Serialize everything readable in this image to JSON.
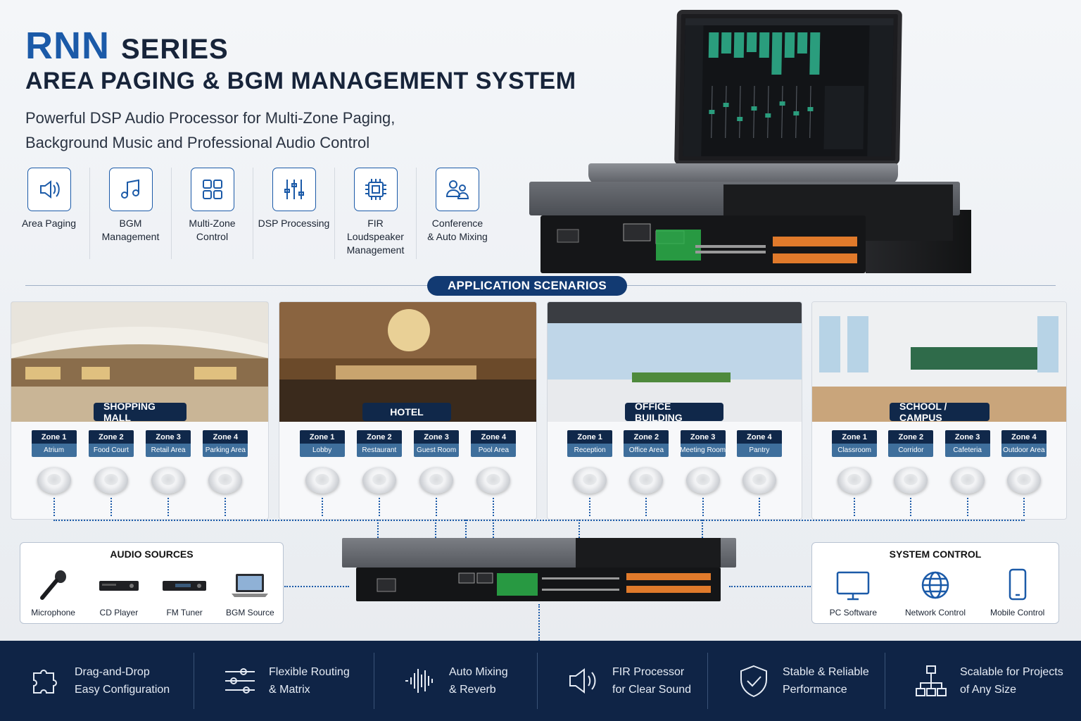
{
  "header": {
    "brand": "RNN",
    "series": "SERIES",
    "subtitle": "AREA PAGING & BGM MANAGEMENT SYSTEM",
    "tagline_1": "Powerful DSP Audio Processor for Multi-Zone Paging,",
    "tagline_2": "Background Music and Professional Audio Control"
  },
  "features": [
    {
      "icon": "speaker-icon",
      "line1": "Area Paging",
      "line2": "",
      "line3": ""
    },
    {
      "icon": "music-note-icon",
      "line1": "BGM",
      "line2": "Management",
      "line3": ""
    },
    {
      "icon": "grid-icon",
      "line1": "Multi-Zone",
      "line2": "Control",
      "line3": ""
    },
    {
      "icon": "sliders-icon",
      "line1": "DSP Processing",
      "line2": "",
      "line3": ""
    },
    {
      "icon": "chip-icon",
      "line1": "FIR",
      "line2": "Loudspeaker",
      "line3": "Management"
    },
    {
      "icon": "people-icon",
      "line1": "Conference",
      "line2": "& Auto Mixing",
      "line3": ""
    }
  ],
  "scenarios_title": "APPLICATION SCENARIOS",
  "scenarios": [
    {
      "name": "SHOPPING MALL",
      "zones": [
        {
          "zone": "Zone 1",
          "area": "Atrium"
        },
        {
          "zone": "Zone 2",
          "area": "Food Court"
        },
        {
          "zone": "Zone 3",
          "area": "Retail Area"
        },
        {
          "zone": "Zone 4",
          "area": "Parking Area"
        }
      ]
    },
    {
      "name": "HOTEL",
      "zones": [
        {
          "zone": "Zone 1",
          "area": "Lobby"
        },
        {
          "zone": "Zone 2",
          "area": "Restaurant"
        },
        {
          "zone": "Zone 3",
          "area": "Guest Room"
        },
        {
          "zone": "Zone 4",
          "area": "Pool Area"
        }
      ]
    },
    {
      "name": "OFFICE BUILDING",
      "zones": [
        {
          "zone": "Zone 1",
          "area": "Reception"
        },
        {
          "zone": "Zone 2",
          "area": "Office Area"
        },
        {
          "zone": "Zone 3",
          "area": "Meeting Room"
        },
        {
          "zone": "Zone 4",
          "area": "Pantry"
        }
      ]
    },
    {
      "name": "SCHOOL / CAMPUS",
      "zones": [
        {
          "zone": "Zone 1",
          "area": "Classroom"
        },
        {
          "zone": "Zone 2",
          "area": "Corridor"
        },
        {
          "zone": "Zone 3",
          "area": "Cafeteria"
        },
        {
          "zone": "Zone 4",
          "area": "Outdoor Area"
        }
      ]
    }
  ],
  "audio_sources": {
    "title": "AUDIO SOURCES",
    "items": [
      {
        "icon": "microphone-icon",
        "label": "Microphone"
      },
      {
        "icon": "cd-player-icon",
        "label": "CD Player"
      },
      {
        "icon": "fm-tuner-icon",
        "label": "FM Tuner"
      },
      {
        "icon": "laptop-icon",
        "label": "BGM Source"
      }
    ]
  },
  "system_control": {
    "title": "SYSTEM CONTROL",
    "items": [
      {
        "icon": "monitor-icon",
        "label": "PC Software"
      },
      {
        "icon": "globe-icon",
        "label": "Network Control"
      },
      {
        "icon": "phone-icon",
        "label": "Mobile Control"
      }
    ]
  },
  "footer": [
    {
      "icon": "puzzle-icon",
      "line1": "Drag-and-Drop",
      "line2": "Easy Configuration"
    },
    {
      "icon": "routing-sliders-icon",
      "line1": "Flexible Routing",
      "line2": "& Matrix"
    },
    {
      "icon": "waveform-icon",
      "line1": "Auto Mixing",
      "line2": "& Reverb"
    },
    {
      "icon": "speaker-outline-icon",
      "line1": "FIR Processor",
      "line2": "for Clear Sound"
    },
    {
      "icon": "shield-check-icon",
      "line1": "Stable & Reliable",
      "line2": "Performance"
    },
    {
      "icon": "network-tree-icon",
      "line1": "Scalable for Projects",
      "line2": "of Any Size"
    }
  ],
  "colors": {
    "brand_blue": "#1b5aa8",
    "navy": "#10284a",
    "footer_bg": "#0f2446",
    "zone_area": "#3f6f9c"
  }
}
